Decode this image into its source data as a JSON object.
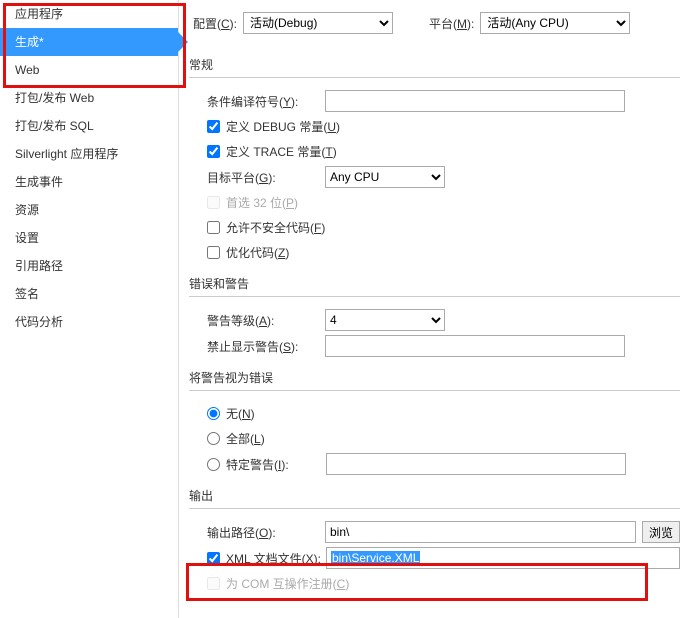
{
  "sidebar": {
    "items": [
      {
        "label": "应用程序"
      },
      {
        "label": "生成*"
      },
      {
        "label": "Web"
      },
      {
        "label": "打包/发布 Web"
      },
      {
        "label": "打包/发布 SQL"
      },
      {
        "label": "Silverlight 应用程序"
      },
      {
        "label": "生成事件"
      },
      {
        "label": "资源"
      },
      {
        "label": "设置"
      },
      {
        "label": "引用路径"
      },
      {
        "label": "签名"
      },
      {
        "label": "代码分析"
      }
    ]
  },
  "top": {
    "config_label_pre": "配置(",
    "config_label_key": "C",
    "config_label_post": "):",
    "config_value": "活动(Debug)",
    "platform_label_pre": "平台(",
    "platform_label_key": "M",
    "platform_label_post": "):",
    "platform_value": "活动(Any CPU)"
  },
  "sections": {
    "general": "常规",
    "errors": "错误和警告",
    "treat_warnings": "将警告视为错误",
    "output": "输出"
  },
  "general": {
    "cond_label_pre": "条件编译符号(",
    "cond_label_key": "Y",
    "cond_label_post": "):",
    "cond_value": "",
    "debug_label_pre": "定义 DEBUG 常量(",
    "debug_label_key": "U",
    "debug_label_post": ")",
    "trace_label_pre": "定义 TRACE 常量(",
    "trace_label_key": "T",
    "trace_label_post": ")",
    "target_label_pre": "目标平台(",
    "target_label_key": "G",
    "target_label_post": "):",
    "target_value": "Any CPU",
    "prefer32_label_pre": "首选 32 位(",
    "prefer32_label_key": "P",
    "prefer32_label_post": ")",
    "unsafe_label_pre": "允许不安全代码(",
    "unsafe_label_key": "F",
    "unsafe_label_post": ")",
    "optimize_label_pre": "优化代码(",
    "optimize_label_key": "Z",
    "optimize_label_post": ")"
  },
  "errors": {
    "level_label_pre": "警告等级(",
    "level_label_key": "A",
    "level_label_post": "):",
    "level_value": "4",
    "suppress_label_pre": "禁止显示警告(",
    "suppress_label_key": "S",
    "suppress_label_post": "):",
    "suppress_value": ""
  },
  "treat": {
    "none_label_pre": "无(",
    "none_label_key": "N",
    "none_label_post": ")",
    "all_label_pre": "全部(",
    "all_label_key": "L",
    "all_label_post": ")",
    "specific_label_pre": "特定警告(",
    "specific_label_key": "I",
    "specific_label_post": "):",
    "specific_value": ""
  },
  "output": {
    "path_label_pre": "输出路径(",
    "path_label_key": "O",
    "path_label_post": "):",
    "path_value": "bin\\",
    "browse_label": "浏览",
    "xml_label_pre": "XML 文档文件(",
    "xml_label_key": "X",
    "xml_label_post": "):",
    "xml_value": "bin\\Service.XML",
    "com_label_pre": "为 COM 互操作注册(",
    "com_label_key": "C",
    "com_label_post": ")"
  }
}
